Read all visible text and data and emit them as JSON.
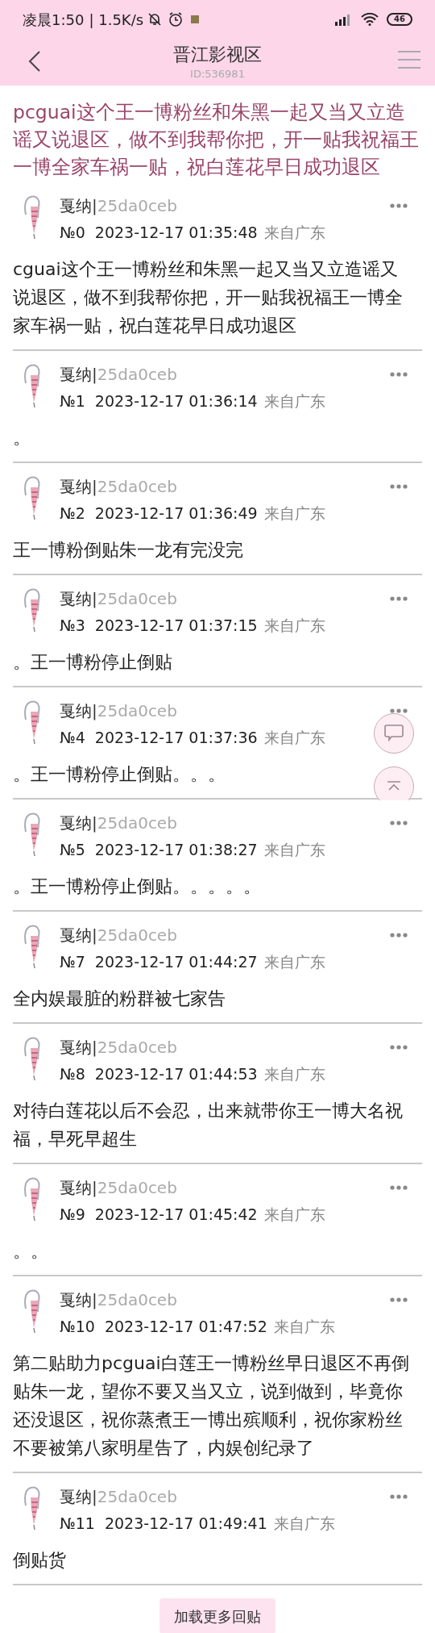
{
  "status_bar": {
    "time": "凌晨1:50",
    "speed": "| 1.5K/s",
    "battery": "46"
  },
  "header": {
    "title": "晋江影视区",
    "id": "ID:536981"
  },
  "thread_title": "pcguai这个王一博粉丝和朱黑一起又当又立造谣又说退区，做不到我帮你把，开一贴我祝福王一博全家车祸一贴，祝白莲花早日成功退区",
  "posts": [
    {
      "name": "戛纳|",
      "uid": "25da0ceb",
      "number": "№0",
      "time": "2023-12-17 01:35:48",
      "location": "来自广东",
      "body": "cguai这个王一博粉丝和朱黑一起又当又立造谣又说退区，做不到我帮你把，开一贴我祝福王一博全家车祸一贴，祝白莲花早日成功退区"
    },
    {
      "name": "戛纳|",
      "uid": "25da0ceb",
      "number": "№1",
      "time": "2023-12-17 01:36:14",
      "location": "来自广东",
      "body": "。"
    },
    {
      "name": "戛纳|",
      "uid": "25da0ceb",
      "number": "№2",
      "time": "2023-12-17 01:36:49",
      "location": "来自广东",
      "body": "王一博粉倒贴朱一龙有完没完"
    },
    {
      "name": "戛纳|",
      "uid": "25da0ceb",
      "number": "№3",
      "time": "2023-12-17 01:37:15",
      "location": "来自广东",
      "body": "。王一博粉停止倒贴"
    },
    {
      "name": "戛纳|",
      "uid": "25da0ceb",
      "number": "№4",
      "time": "2023-12-17 01:37:36",
      "location": "来自广东",
      "body": "。王一博粉停止倒贴。。。"
    },
    {
      "name": "戛纳|",
      "uid": "25da0ceb",
      "number": "№5",
      "time": "2023-12-17 01:38:27",
      "location": "来自广东",
      "body": "。王一博粉停止倒贴。。。。。"
    },
    {
      "name": "戛纳|",
      "uid": "25da0ceb",
      "number": "№7",
      "time": "2023-12-17 01:44:27",
      "location": "来自广东",
      "body": "全内娱最脏的粉群被七家告"
    },
    {
      "name": "戛纳|",
      "uid": "25da0ceb",
      "number": "№8",
      "time": "2023-12-17 01:44:53",
      "location": "来自广东",
      "body": "对待白莲花以后不会忍，出来就带你王一博大名祝福，早死早超生"
    },
    {
      "name": "戛纳|",
      "uid": "25da0ceb",
      "number": "№9",
      "time": "2023-12-17 01:45:42",
      "location": "来自广东",
      "body": "。。"
    },
    {
      "name": "戛纳|",
      "uid": "25da0ceb",
      "number": "№10",
      "time": "2023-12-17 01:47:52",
      "location": "来自广东",
      "body": "第二贴助力pcguai白莲王一博粉丝早日退区不再倒贴朱一龙，望你不要又当又立，说到做到，毕竟你还没退区，祝你蒸煮王一博出殡顺利，祝你家粉丝不要被第八家明星告了，内娱创纪录了"
    },
    {
      "name": "戛纳|",
      "uid": "25da0ceb",
      "number": "№11",
      "time": "2023-12-17 01:49:41",
      "location": "来自广东",
      "body": "倒贴货"
    }
  ],
  "load_more": "加载更多回贴"
}
